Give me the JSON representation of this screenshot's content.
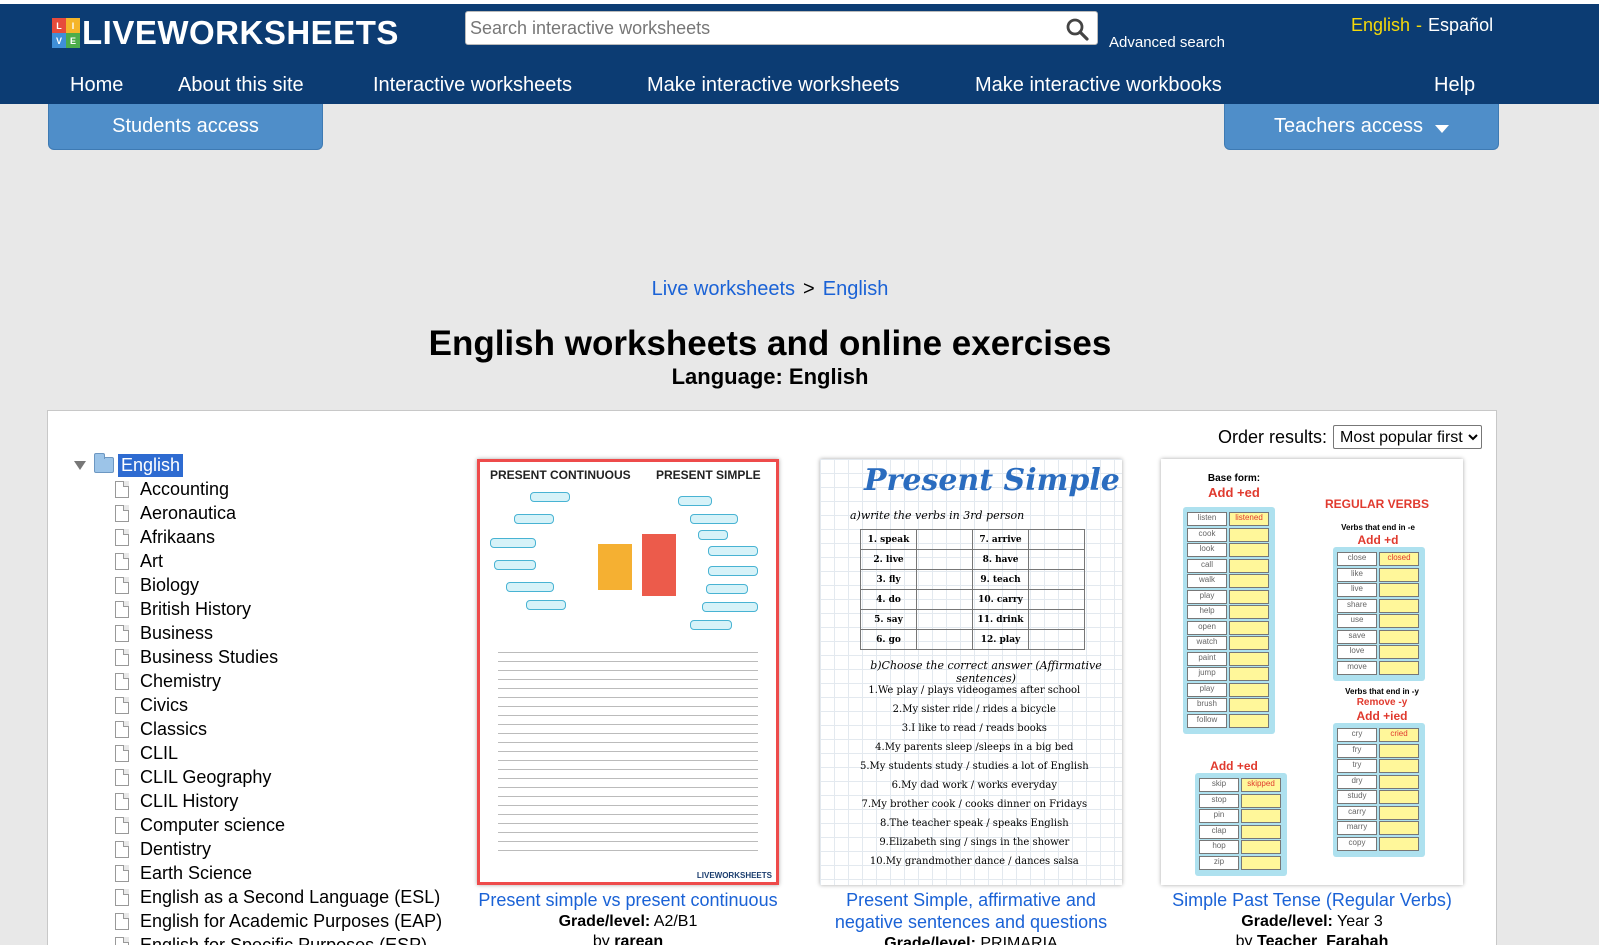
{
  "header": {
    "logo_cube_letters": [
      "L",
      "I",
      "V",
      "E"
    ],
    "logo_text": "LIVEWORKSHEETS",
    "search": {
      "placeholder": "Search interactive worksheets"
    },
    "advanced_search": "Advanced search",
    "languages": {
      "active": "English",
      "separator": "-",
      "other": "Español"
    },
    "nav": [
      "Home",
      "About this site",
      "Interactive worksheets",
      "Make interactive worksheets",
      "Make interactive workbooks",
      "Help"
    ]
  },
  "access": {
    "students": "Students access",
    "teachers": "Teachers access"
  },
  "breadcrumb": {
    "root": "Live worksheets",
    "separator": ">",
    "current": "English"
  },
  "page": {
    "title": "English worksheets and online exercises",
    "subtitle": "Language: English"
  },
  "order": {
    "label": "Order results:",
    "selected": "Most popular first"
  },
  "tree": {
    "root": "English",
    "items": [
      "Accounting",
      "Aeronautica",
      "Afrikaans",
      "Art",
      "Biology",
      "British History",
      "Business",
      "Business Studies",
      "Chemistry",
      "Civics",
      "Classics",
      "CLIL",
      "CLIL Geography",
      "CLIL History",
      "Computer science",
      "Dentistry",
      "Earth Science",
      "English as a Second Language (ESL)",
      "English for Academic Purposes (EAP)",
      "English for Specific Purposes (ESP)"
    ]
  },
  "cards": [
    {
      "title": "Present simple vs present continuous",
      "grade_label": "Grade/level:",
      "grade": "A2/B1",
      "author_label": "by",
      "author": "rarean",
      "thumb": {
        "left_heading": "PRESENT CONTINUOUS",
        "right_heading": "PRESENT SIMPLE",
        "footer": "LIVEWORKSHEETS"
      }
    },
    {
      "title": "Present Simple, affirmative and negative sentences and questions",
      "grade_label": "Grade/level:",
      "grade": "PRIMARIA",
      "thumb": {
        "heading": "Present Simple",
        "instruction_a": "a)write the verbs in 3rd person",
        "verbs": [
          [
            "1. speak",
            "7. arrive"
          ],
          [
            "2. live",
            "8. have"
          ],
          [
            "3. fly",
            "9. teach"
          ],
          [
            "4. do",
            "10. carry"
          ],
          [
            "5. say",
            "11. drink"
          ],
          [
            "6. go",
            "12. play"
          ]
        ],
        "instruction_b": "b)Choose the correct answer (Affirmative sentences)",
        "sentences": [
          "1.We play / plays videogames after school",
          "2.My sister ride / rides a bicycle",
          "3.I like to read / reads books",
          "4.My parents sleep /sleeps in a big bed",
          "5.My students study / studies a lot of English",
          "6.My dad work / works everyday",
          "7.My brother cook / cooks dinner on Fridays",
          "8.The teacher speak / speaks English",
          "9.Elizabeth sing / sings in the shower",
          "10.My grandmother dance / dances salsa"
        ]
      }
    },
    {
      "title": "Simple Past Tense (Regular Verbs)",
      "grade_label": "Grade/level:",
      "grade": "Year 3",
      "author_label": "by",
      "author": "Teacher_Farahah",
      "thumb": {
        "base_label": "Base form:",
        "add_ed": "Add +ed",
        "regular_verbs": "REGULAR VERBS",
        "ends_e": "Verbs that end in -e",
        "add_d": "Add +d",
        "ends_y": "Verbs that end in -y",
        "remove_y": "Remove -y",
        "add_ied": "Add +ied",
        "col1": [
          "listen",
          "cook",
          "look",
          "call",
          "walk",
          "play",
          "help",
          "open",
          "watch",
          "paint",
          "jump",
          "play",
          "brush",
          "follow"
        ],
        "col1_example": "listened",
        "col2": [
          "close",
          "like",
          "live",
          "share",
          "use",
          "save",
          "love",
          "move"
        ],
        "col2_example": "closed",
        "col3": [
          "skip",
          "stop",
          "pin",
          "clap",
          "hop",
          "zip"
        ],
        "col3_example": "skipped",
        "col4": [
          "cry",
          "fry",
          "try",
          "dry",
          "study",
          "carry",
          "marry",
          "copy"
        ],
        "col4_example": "cried"
      }
    }
  ],
  "colors": {
    "header_bg": "#0c3c73",
    "accent": "#4f8ec9",
    "link": "#1a62d6",
    "active_lang": "#f5d90a"
  }
}
